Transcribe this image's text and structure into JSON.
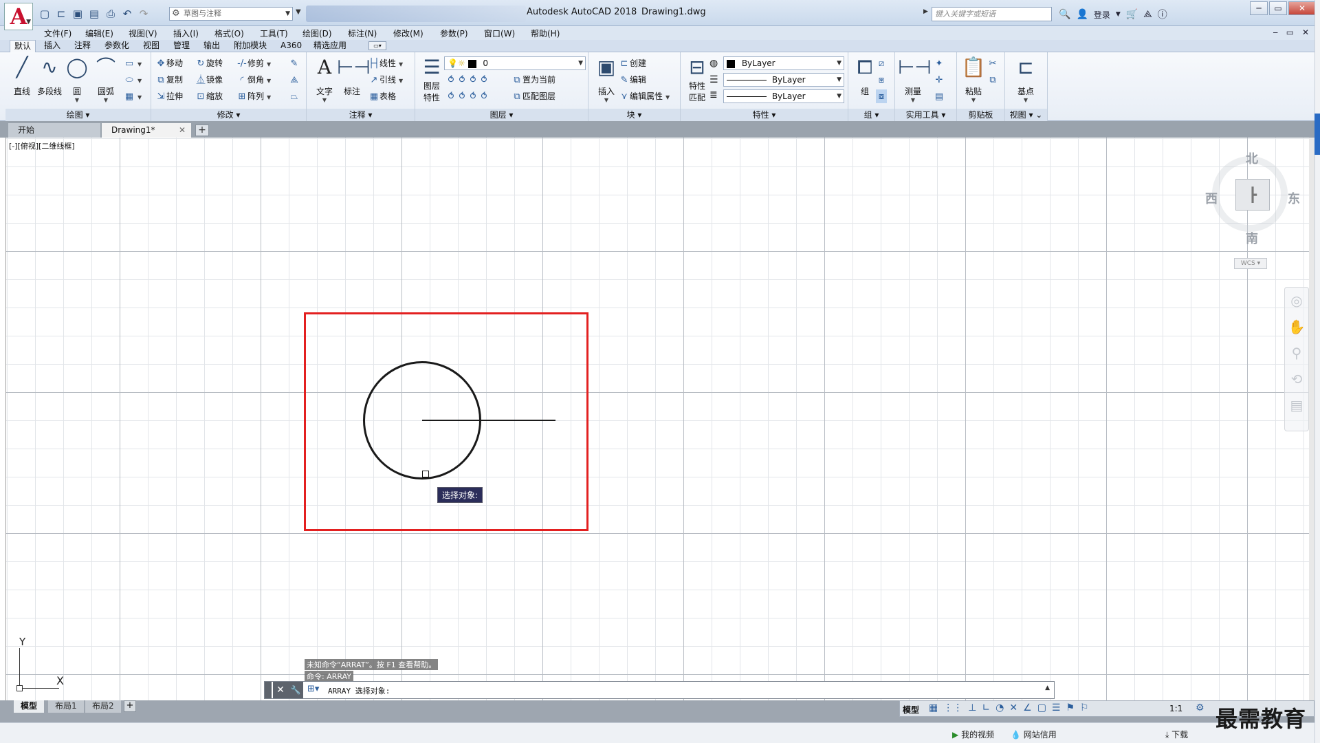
{
  "app": {
    "title": "Autodesk AutoCAD 2018",
    "document": "Drawing1.dwg",
    "workspace": "草图与注释",
    "search_placeholder": "键入关键字或短语",
    "login": "登录"
  },
  "menu": [
    "文件(F)",
    "编辑(E)",
    "视图(V)",
    "插入(I)",
    "格式(O)",
    "工具(T)",
    "绘图(D)",
    "标注(N)",
    "修改(M)",
    "参数(P)",
    "窗口(W)",
    "帮助(H)"
  ],
  "ribbon_tabs": [
    "默认",
    "插入",
    "注释",
    "参数化",
    "视图",
    "管理",
    "输出",
    "附加模块",
    "A360",
    "精选应用"
  ],
  "ribbon": {
    "draw": {
      "label": "绘图",
      "line": "直线",
      "polyline": "多段线",
      "circle": "圆",
      "arc": "圆弧"
    },
    "modify": {
      "label": "修改",
      "move": "移动",
      "rotate": "旋转",
      "trim": "修剪",
      "copy": "复制",
      "mirror": "镜像",
      "fillet": "倒角",
      "stretch": "拉伸",
      "scale": "缩放",
      "array": "阵列"
    },
    "annotation": {
      "label": "注释",
      "text": "文字",
      "dim": "标注",
      "linear": "线性",
      "leader": "引线",
      "table": "表格"
    },
    "layers": {
      "label": "图层",
      "props": "图层",
      "props2": "特性",
      "current_layer": "0",
      "set_current": "置为当前",
      "match_layer": "匹配图层"
    },
    "block": {
      "label": "块",
      "insert": "插入",
      "create": "创建",
      "edit": "编辑",
      "edit_attr": "编辑属性"
    },
    "properties": {
      "label": "特性",
      "match": "特性",
      "match2": "匹配",
      "color": "ByLayer",
      "linetype": "ByLayer",
      "lineweight": "ByLayer"
    },
    "groups": {
      "label": "组",
      "group": "组"
    },
    "utilities": {
      "label": "实用工具",
      "measure": "测量"
    },
    "clipboard": {
      "label": "剪贴板",
      "paste": "粘贴"
    },
    "view": {
      "label": "视图",
      "base": "基点"
    }
  },
  "file_tabs": {
    "start": "开始",
    "drawing": "Drawing1*"
  },
  "viewport_label": "[-][俯视][二维线框]",
  "viewcube": {
    "north": "北",
    "south": "南",
    "east": "东",
    "west": "西",
    "wcs": "WCS"
  },
  "ucs": {
    "x": "X",
    "y": "Y"
  },
  "tooltip": "选择对象:",
  "command_history": [
    "未知命令“ARRAT”。按 F1 查看帮助。",
    "命令: ARRAY"
  ],
  "command_line": "ARRAY 选择对象:",
  "layout_tabs": [
    "模型",
    "布局1",
    "布局2"
  ],
  "status": {
    "model": "模型",
    "scale": "1:1"
  },
  "bottom_bar": {
    "video": "我的视频",
    "credit": "网站信用",
    "download": "下载"
  },
  "watermark": "最需教育",
  "colors": {
    "selection": "#e32020",
    "tooltip_bg": "#2b2d5a",
    "accent": "#2a6bc4"
  }
}
